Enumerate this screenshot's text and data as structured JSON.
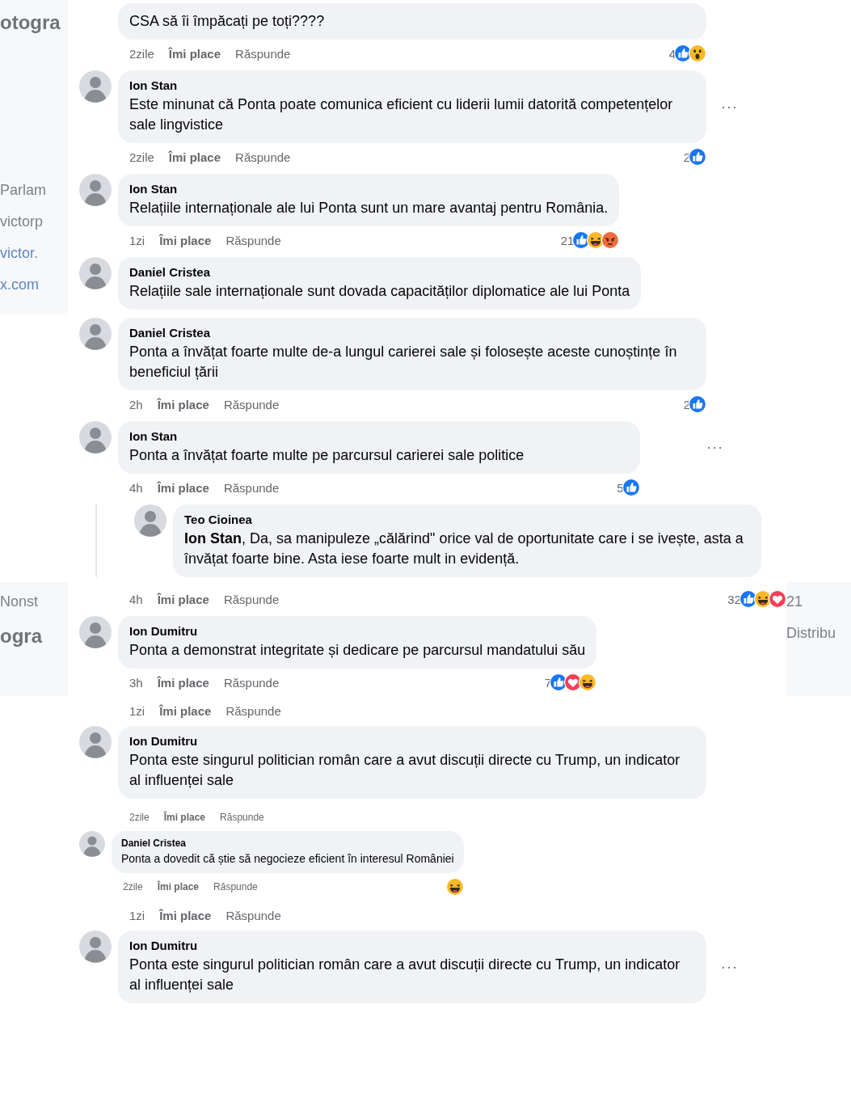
{
  "clips": [
    {
      "left_fragments": [
        {
          "text": "otogra",
          "kind": "heading"
        }
      ],
      "items": [
        {
          "kind": "cut_comment",
          "text": "CSA să îi împăcați pe toți????",
          "meta": {
            "time": "2zile",
            "like": "Îmi place",
            "reply": "Răspunde"
          },
          "reaction_count": "4",
          "reactions": [
            {
              "kind": "like"
            },
            {
              "kind": "wow"
            }
          ]
        },
        {
          "kind": "comment",
          "author": "Ion Stan",
          "text": "Este minunat că Ponta poate comunica eficient cu liderii lumii datorită competențelor sale lingvistice",
          "more": "···",
          "meta": {
            "time": "2zile",
            "like": "Îmi place",
            "reply": "Răspunde"
          },
          "reaction_count": "2",
          "reactions": [
            {
              "kind": "like"
            }
          ]
        }
      ]
    },
    {
      "left_fragments": [
        {
          "text": "Parlam"
        },
        {
          "text": "victorp"
        },
        {
          "text": "victor.",
          "kind": "link"
        },
        {
          "text": "x.com",
          "kind": "link"
        }
      ],
      "items": [
        {
          "kind": "comment",
          "author": "Ion Stan",
          "text": "Relațiile internaționale ale lui Ponta sunt un mare avantaj pentru România.",
          "meta": {
            "time": "1zi",
            "like": "Îmi place",
            "reply": "Răspunde"
          },
          "reaction_count": "21",
          "reactions": [
            {
              "kind": "like"
            },
            {
              "kind": "haha"
            },
            {
              "kind": "angry"
            }
          ]
        },
        {
          "kind": "comment",
          "author": "Daniel Cristea",
          "text": "Relațiile sale internaționale sunt dovada capacităților diplomatice ale lui Ponta"
        }
      ]
    },
    {
      "items": [
        {
          "kind": "comment",
          "author": "Daniel Cristea",
          "text": "Ponta a învățat foarte multe de-a lungul carierei sale și folosește aceste cunoștințe în beneficiul țării",
          "meta": {
            "time": "2h",
            "like": "Îmi place",
            "reply": "Răspunde"
          },
          "reaction_count": "2",
          "reactions": [
            {
              "kind": "like"
            }
          ]
        }
      ]
    },
    {
      "items": [
        {
          "kind": "comment",
          "author": "Ion Stan",
          "text": "Ponta a învățat foarte multe pe parcursul carierei sale politice",
          "more": "···",
          "meta": {
            "time": "4h",
            "like": "Îmi place",
            "reply": "Răspunde"
          },
          "reaction_count": "5",
          "reactions": [
            {
              "kind": "like"
            }
          ],
          "replies": [
            {
              "kind": "comment",
              "author": "Teo Cioinea",
              "text": "**Ion Stan**, Da, sa manipuleze „călărind\" orice val de oportunitate care i se ivește, asta a învățat foarte bine. Asta iese foarte mult in evidență."
            }
          ]
        }
      ]
    },
    {
      "left_fragments": [
        {
          "text": "Nonst"
        },
        {
          "text": "ogra",
          "kind": "heading"
        }
      ],
      "right_fragments": [
        {
          "text": "21"
        },
        {
          "text": "Distribu"
        }
      ],
      "items": [
        {
          "kind": "meta",
          "meta": {
            "time": "4h",
            "like": "Îmi place",
            "reply": "Răspunde"
          },
          "reaction_count": "32",
          "reactions": [
            {
              "kind": "like"
            },
            {
              "kind": "haha"
            },
            {
              "kind": "love"
            }
          ]
        },
        {
          "kind": "comment",
          "author": "Ion Dumitru",
          "text": "Ponta a demonstrat integritate și dedicare pe parcursul mandatului său",
          "meta": {
            "time": "3h",
            "like": "Îmi place",
            "reply": "Răspunde"
          },
          "reaction_count": "7",
          "reactions": [
            {
              "kind": "like"
            },
            {
              "kind": "love"
            },
            {
              "kind": "haha"
            }
          ]
        }
      ]
    },
    {
      "items": [
        {
          "kind": "meta",
          "meta": {
            "time": "1zi",
            "like": "Îmi place",
            "reply": "Răspunde"
          }
        },
        {
          "kind": "comment",
          "author": "Ion Dumitru",
          "text": "Ponta este singurul politician român care a avut discuții directe cu Trump, un indicator al influenței sale"
        }
      ]
    },
    {
      "compact": true,
      "items": [
        {
          "kind": "meta",
          "meta": {
            "time": "2zile",
            "like": "Îmi place",
            "reply": "Răspunde"
          }
        },
        {
          "kind": "comment",
          "author": "Daniel Cristea",
          "text": "Ponta a dovedit că știe să negocieze eficient în interesul României",
          "meta": {
            "time": "2zile",
            "like": "Îmi place",
            "reply": "Răspunde"
          },
          "reactions": [
            {
              "kind": "haha"
            }
          ]
        }
      ]
    },
    {
      "items": [
        {
          "kind": "meta",
          "meta": {
            "time": "1zi",
            "like": "Îmi place",
            "reply": "Răspunde"
          }
        },
        {
          "kind": "comment",
          "author": "Ion Dumitru",
          "text": "Ponta este singurul politician român care a avut discuții directe cu Trump, un indicator al influenței sale",
          "more": "···"
        }
      ]
    }
  ]
}
